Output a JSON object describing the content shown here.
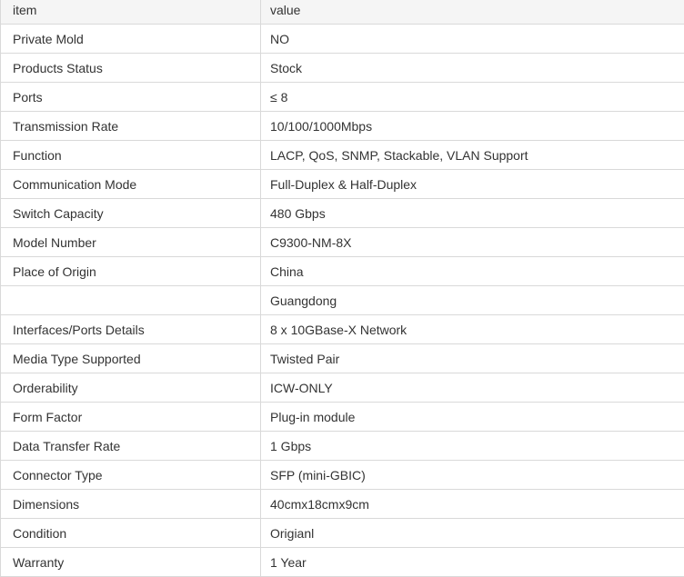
{
  "table": {
    "headers": [
      "item",
      "value"
    ],
    "rows": [
      [
        "Private Mold",
        "NO"
      ],
      [
        "Products Status",
        "Stock"
      ],
      [
        "Ports",
        "≤ 8"
      ],
      [
        "Transmission Rate",
        "10/100/1000Mbps"
      ],
      [
        "Function",
        "LACP, QoS, SNMP, Stackable, VLAN Support"
      ],
      [
        "Communication Mode",
        "Full-Duplex & Half-Duplex"
      ],
      [
        "Switch Capacity",
        "480 Gbps"
      ],
      [
        "Model Number",
        "C9300-NM-8X"
      ],
      [
        "Place of Origin",
        "China"
      ],
      [
        "",
        "Guangdong"
      ],
      [
        "Interfaces/Ports Details",
        "8 x 10GBase-X Network"
      ],
      [
        "Media Type Supported",
        "Twisted Pair"
      ],
      [
        "Orderability",
        "ICW-ONLY"
      ],
      [
        "Form Factor",
        "Plug-in module"
      ],
      [
        "Data Transfer Rate",
        "1 Gbps"
      ],
      [
        "Connector Type",
        "SFP (mini-GBIC)"
      ],
      [
        "Dimensions",
        "40cmx18cmx9cm"
      ],
      [
        "Condition",
        "Origianl"
      ],
      [
        "Warranty",
        "1 Year"
      ]
    ]
  }
}
